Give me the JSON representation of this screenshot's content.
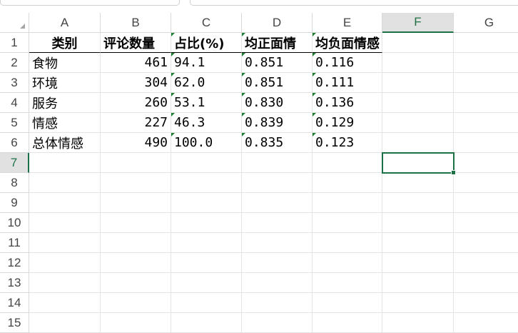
{
  "columns": [
    "A",
    "B",
    "C",
    "D",
    "E",
    "F",
    "G"
  ],
  "active_column": "F",
  "rows": [
    "1",
    "2",
    "3",
    "4",
    "5",
    "6",
    "7",
    "8",
    "9",
    "10",
    "11",
    "12",
    "13",
    "14",
    "15"
  ],
  "active_row": "7",
  "header_row": [
    "类别",
    "评论数量",
    "占比(%)",
    "均正面情",
    "均负面情感"
  ],
  "data_rows": [
    [
      "食物",
      "461",
      "94.1",
      "0.851",
      "0.116"
    ],
    [
      "环境",
      "304",
      "62.0",
      "0.851",
      "0.111"
    ],
    [
      "服务",
      "260",
      "53.1",
      "0.830",
      "0.136"
    ],
    [
      "情感",
      "227",
      "46.3",
      "0.839",
      "0.129"
    ],
    [
      "总体情感",
      "490",
      "100.0",
      "0.835",
      "0.123"
    ]
  ],
  "colors": {
    "accent": "#1e7145",
    "gridline": "#e4e4e4",
    "header_text": "#444444"
  }
}
